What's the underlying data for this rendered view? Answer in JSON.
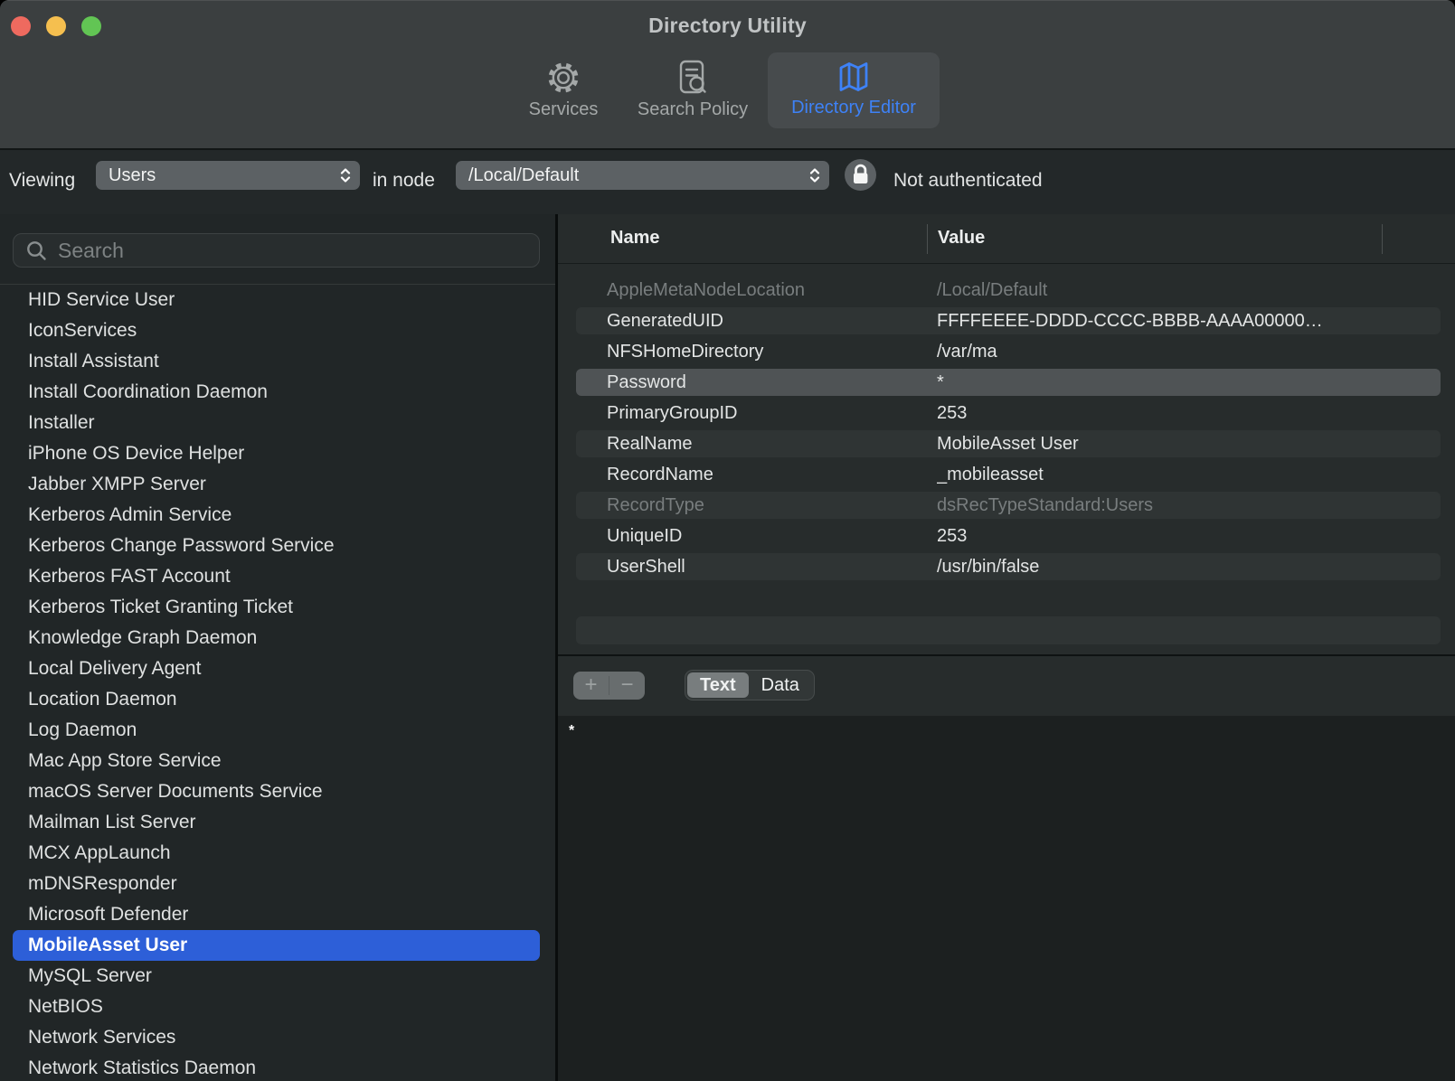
{
  "window": {
    "title": "Directory Utility"
  },
  "toolbar": {
    "items": [
      {
        "label": "Services",
        "icon": "gear-icon",
        "selected": false
      },
      {
        "label": "Search Policy",
        "icon": "document-search-icon",
        "selected": false
      },
      {
        "label": "Directory Editor",
        "icon": "map-icon",
        "selected": true
      }
    ]
  },
  "viewing_bar": {
    "viewing_label": "Viewing",
    "record_type": "Users",
    "in_node_label": "in node",
    "node": "/Local/Default",
    "lock_icon": "lock-icon",
    "auth_status": "Not authenticated"
  },
  "sidebar": {
    "search_placeholder": "Search",
    "selected_item": "MobileAsset User",
    "items": [
      "HID Service User",
      "IconServices",
      "Install Assistant",
      "Install Coordination Daemon",
      "Installer",
      "iPhone OS Device Helper",
      "Jabber XMPP Server",
      "Kerberos Admin Service",
      "Kerberos Change Password Service",
      "Kerberos FAST Account",
      "Kerberos Ticket Granting Ticket",
      "Knowledge Graph Daemon",
      "Local Delivery Agent",
      "Location Daemon",
      "Log Daemon",
      "Mac App Store Service",
      "macOS Server Documents Service",
      "Mailman List Server",
      "MCX AppLaunch",
      "mDNSResponder",
      "Microsoft Defender",
      "MobileAsset User",
      "MySQL Server",
      "NetBIOS",
      "Network Services",
      "Network Statistics Daemon"
    ]
  },
  "table": {
    "columns": [
      "Name",
      "Value"
    ],
    "rows": [
      {
        "name": "AppleMetaNodeLocation",
        "value": "/Local/Default",
        "dimmed": true,
        "selected": false
      },
      {
        "name": "GeneratedUID",
        "value": "FFFFEEEE-DDDD-CCCC-BBBB-AAAA00000…",
        "dimmed": false,
        "selected": false
      },
      {
        "name": "NFSHomeDirectory",
        "value": "/var/ma",
        "dimmed": false,
        "selected": false
      },
      {
        "name": "Password",
        "value": "*",
        "dimmed": false,
        "selected": true
      },
      {
        "name": "PrimaryGroupID",
        "value": "253",
        "dimmed": false,
        "selected": false
      },
      {
        "name": "RealName",
        "value": "MobileAsset User",
        "dimmed": false,
        "selected": false
      },
      {
        "name": "RecordName",
        "value": "_mobileasset",
        "dimmed": false,
        "selected": false
      },
      {
        "name": "RecordType",
        "value": "dsRecTypeStandard:Users",
        "dimmed": true,
        "selected": false
      },
      {
        "name": "UniqueID",
        "value": "253",
        "dimmed": false,
        "selected": false
      },
      {
        "name": "UserShell",
        "value": "/usr/bin/false",
        "dimmed": false,
        "selected": false
      }
    ]
  },
  "editor": {
    "add_label": "+",
    "remove_label": "−",
    "modes": [
      "Text",
      "Data"
    ],
    "selected_mode": "Text",
    "content": "*"
  },
  "colors": {
    "accent_blue": "#3e82f7",
    "selection_blue": "#2d5fd8",
    "row_selected_gray": "#4f5355",
    "traffic_red": "#ee6a5f",
    "traffic_yellow": "#f5bf4f",
    "traffic_green": "#62c554"
  }
}
